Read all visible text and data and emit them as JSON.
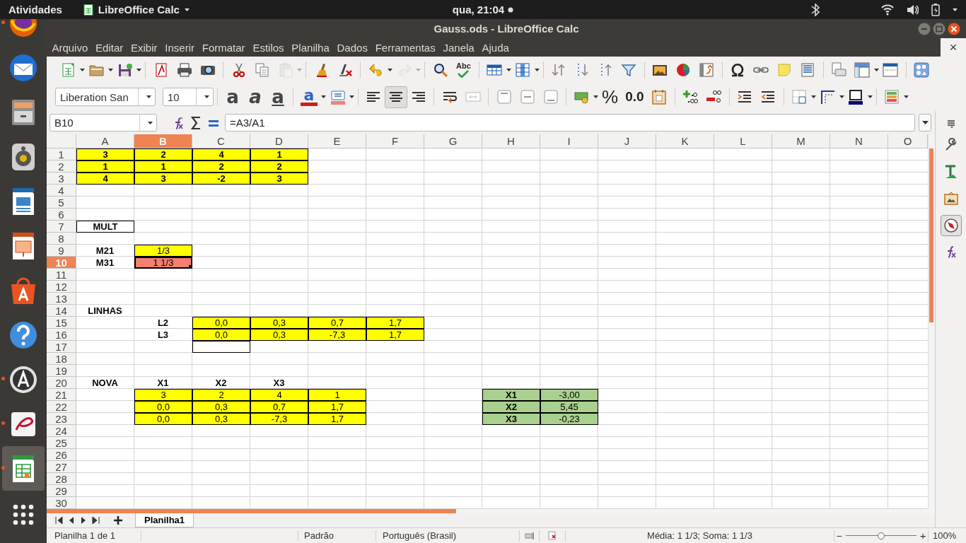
{
  "top_bar": {
    "activities": "Atividades",
    "app_menu": "LibreOffice Calc",
    "clock": "qua, 21:04"
  },
  "dock": {
    "items": [
      {
        "running": true,
        "selected": false
      },
      {
        "running": false,
        "selected": false
      },
      {
        "running": false,
        "selected": false
      },
      {
        "running": false,
        "selected": false
      },
      {
        "running": false,
        "selected": false
      },
      {
        "running": false,
        "selected": false
      },
      {
        "running": false,
        "selected": false
      },
      {
        "running": false,
        "selected": false
      },
      {
        "running": true,
        "selected": false
      },
      {
        "running": true,
        "selected": false
      },
      {
        "running": true,
        "selected": true
      }
    ]
  },
  "window": {
    "title": "Gauss.ods - LibreOffice Calc",
    "close_document": "×"
  },
  "menu_bar": [
    "Arquivo",
    "Editar",
    "Exibir",
    "Inserir",
    "Formatar",
    "Estilos",
    "Planilha",
    "Dados",
    "Ferramentas",
    "Janela",
    "Ajuda"
  ],
  "standard_toolbar": {
    "spelling_label": "Abc",
    "paste": {
      "disabled": true
    },
    "redo": {
      "disabled": true
    }
  },
  "formatting_toolbar": {
    "font_name": "Liberation San",
    "font_size": "10",
    "text_buttons": [
      {
        "label": "a",
        "selected": false
      },
      {
        "label": "a",
        "selected": false
      },
      {
        "label": "a",
        "selected": false
      }
    ],
    "font_color": {
      "label": "a"
    },
    "align_buttons": [
      {
        "selected": false
      },
      {
        "selected": true
      },
      {
        "selected": false
      }
    ],
    "percent": "%",
    "decimal": "0.0"
  },
  "formula_bar": {
    "cell_ref": "B10",
    "formula": "=A3/A1"
  },
  "sheet": {
    "columns": [
      {
        "label": "A",
        "selected": false
      },
      {
        "label": "B",
        "selected": true
      },
      {
        "label": "C",
        "selected": false
      },
      {
        "label": "D",
        "selected": false
      },
      {
        "label": "E",
        "selected": false
      },
      {
        "label": "F",
        "selected": false
      },
      {
        "label": "G",
        "selected": false
      },
      {
        "label": "H",
        "selected": false
      },
      {
        "label": "I",
        "selected": false
      },
      {
        "label": "J",
        "selected": false
      },
      {
        "label": "K",
        "selected": false
      },
      {
        "label": "L",
        "selected": false
      },
      {
        "label": "M",
        "selected": false
      },
      {
        "label": "N",
        "selected": false
      },
      {
        "label": "O",
        "selected": false
      }
    ],
    "rows": [
      {
        "label": "1",
        "selected": false,
        "cells": {
          "A": {
            "text": "3",
            "bold": true,
            "bordered": true,
            "color": "#ffff00",
            "selected": false
          },
          "B": {
            "text": "2",
            "bold": true,
            "bordered": true,
            "color": "#ffff00",
            "selected": false
          },
          "C": {
            "text": "4",
            "bold": true,
            "bordered": true,
            "color": "#ffff00",
            "selected": false
          },
          "D": {
            "text": "1",
            "bold": true,
            "bordered": true,
            "color": "#ffff00",
            "selected": false
          }
        }
      },
      {
        "label": "2",
        "selected": false,
        "cells": {
          "A": {
            "text": "1",
            "bold": true,
            "bordered": true,
            "color": "#ffff00",
            "selected": false
          },
          "B": {
            "text": "1",
            "bold": true,
            "bordered": true,
            "color": "#ffff00",
            "selected": false
          },
          "C": {
            "text": "2",
            "bold": true,
            "bordered": true,
            "color": "#ffff00",
            "selected": false
          },
          "D": {
            "text": "2",
            "bold": true,
            "bordered": true,
            "color": "#ffff00",
            "selected": false
          }
        }
      },
      {
        "label": "3",
        "selected": false,
        "cells": {
          "A": {
            "text": "4",
            "bold": true,
            "bordered": true,
            "color": "#ffff00",
            "selected": false
          },
          "B": {
            "text": "3",
            "bold": true,
            "bordered": true,
            "color": "#ffff00",
            "selected": false
          },
          "C": {
            "text": "-2",
            "bold": true,
            "bordered": true,
            "color": "#ffff00",
            "selected": false
          },
          "D": {
            "text": "3",
            "bold": true,
            "bordered": true,
            "color": "#ffff00",
            "selected": false
          }
        }
      },
      {
        "label": "4",
        "selected": false
      },
      {
        "label": "5",
        "selected": false
      },
      {
        "label": "6",
        "selected": false
      },
      {
        "label": "7",
        "selected": false,
        "cells": {
          "A": {
            "text": "MULT",
            "bold": true,
            "bordered": true,
            "selected": false
          }
        }
      },
      {
        "label": "8",
        "selected": false
      },
      {
        "label": "9",
        "selected": false,
        "cells": {
          "A": {
            "text": "M21",
            "bold": true,
            "bordered": false,
            "selected": false
          },
          "B": {
            "text": "1/3",
            "bold": false,
            "bordered": true,
            "color": "#ffff00",
            "selected": false
          }
        }
      },
      {
        "label": "10",
        "selected": true,
        "cells": {
          "A": {
            "text": "M31",
            "bold": true,
            "bordered": false,
            "selected": false
          },
          "B": {
            "text": "1 1/3",
            "bold": false,
            "bordered": true,
            "color": "#f4806f",
            "selected": true
          }
        }
      },
      {
        "label": "11",
        "selected": false
      },
      {
        "label": "12",
        "selected": false
      },
      {
        "label": "13",
        "selected": false
      },
      {
        "label": "14",
        "selected": false,
        "cells": {
          "A": {
            "text": "LINHAS",
            "bold": true,
            "bordered": false,
            "selected": false
          }
        }
      },
      {
        "label": "15",
        "selected": false,
        "cells": {
          "B": {
            "text": "L2",
            "bold": true,
            "bordered": false,
            "selected": false
          },
          "C": {
            "text": "0,0",
            "bold": false,
            "bordered": true,
            "color": "#ffff00",
            "selected": false
          },
          "D": {
            "text": "0,3",
            "bold": false,
            "bordered": true,
            "color": "#ffff00",
            "selected": false
          },
          "E": {
            "text": "0,7",
            "bold": false,
            "bordered": true,
            "color": "#ffff00",
            "selected": false
          },
          "F": {
            "text": "1,7",
            "bold": false,
            "bordered": true,
            "color": "#ffff00",
            "selected": false
          }
        }
      },
      {
        "label": "16",
        "selected": false,
        "cells": {
          "B": {
            "text": "L3",
            "bold": true,
            "bordered": false,
            "selected": false
          },
          "C": {
            "text": "0,0",
            "bold": false,
            "bordered": true,
            "color": "#ffff00",
            "selected": false
          },
          "D": {
            "text": "0,3",
            "bold": false,
            "bordered": true,
            "color": "#ffff00",
            "selected": false
          },
          "E": {
            "text": "-7,3",
            "bold": false,
            "bordered": true,
            "color": "#ffff00",
            "selected": false
          },
          "F": {
            "text": "1,7",
            "bold": false,
            "bordered": true,
            "color": "#ffff00",
            "selected": false
          }
        }
      },
      {
        "label": "17",
        "selected": false,
        "cells": {
          "C": {
            "bold": false,
            "bordered": true,
            "selected": false
          }
        }
      },
      {
        "label": "18",
        "selected": false
      },
      {
        "label": "19",
        "selected": false
      },
      {
        "label": "20",
        "selected": false,
        "cells": {
          "A": {
            "text": "NOVA",
            "bold": true,
            "bordered": false,
            "selected": false
          },
          "B": {
            "text": "X1",
            "bold": true,
            "bordered": false,
            "selected": false
          },
          "C": {
            "text": "X2",
            "bold": true,
            "bordered": false,
            "selected": false
          },
          "D": {
            "text": "X3",
            "bold": true,
            "bordered": false,
            "selected": false
          }
        }
      },
      {
        "label": "21",
        "selected": false,
        "cells": {
          "B": {
            "text": "3",
            "bold": false,
            "bordered": true,
            "color": "#ffff00",
            "selected": false
          },
          "C": {
            "text": "2",
            "bold": false,
            "bordered": true,
            "color": "#ffff00",
            "selected": false
          },
          "D": {
            "text": "4",
            "bold": false,
            "bordered": true,
            "color": "#ffff00",
            "selected": false
          },
          "E": {
            "text": "1",
            "bold": false,
            "bordered": true,
            "color": "#ffff00",
            "selected": false
          },
          "H": {
            "text": "X1",
            "bold": true,
            "bordered": true,
            "color": "#a9d08e",
            "selected": false
          },
          "I": {
            "text": "-3,00",
            "bold": false,
            "bordered": true,
            "color": "#a9d08e",
            "selected": false
          }
        }
      },
      {
        "label": "22",
        "selected": false,
        "cells": {
          "B": {
            "text": "0,0",
            "bold": false,
            "bordered": true,
            "color": "#ffff00",
            "selected": false
          },
          "C": {
            "text": "0,3",
            "bold": false,
            "bordered": true,
            "color": "#ffff00",
            "selected": false
          },
          "D": {
            "text": "0,7",
            "bold": false,
            "bordered": true,
            "color": "#ffff00",
            "selected": false
          },
          "E": {
            "text": "1,7",
            "bold": false,
            "bordered": true,
            "color": "#ffff00",
            "selected": false
          },
          "H": {
            "text": "X2",
            "bold": true,
            "bordered": true,
            "color": "#a9d08e",
            "selected": false
          },
          "I": {
            "text": "5,45",
            "bold": false,
            "bordered": true,
            "color": "#a9d08e",
            "selected": false
          }
        }
      },
      {
        "label": "23",
        "selected": false,
        "cells": {
          "B": {
            "text": "0,0",
            "bold": false,
            "bordered": true,
            "color": "#ffff00",
            "selected": false
          },
          "C": {
            "text": "0,3",
            "bold": false,
            "bordered": true,
            "color": "#ffff00",
            "selected": false
          },
          "D": {
            "text": "-7,3",
            "bold": false,
            "bordered": true,
            "color": "#ffff00",
            "selected": false
          },
          "E": {
            "text": "1,7",
            "bold": false,
            "bordered": true,
            "color": "#ffff00",
            "selected": false
          },
          "H": {
            "text": "X3",
            "bold": true,
            "bordered": true,
            "color": "#a9d08e",
            "selected": false
          },
          "I": {
            "text": "-0,23",
            "bold": false,
            "bordered": true,
            "color": "#a9d08e",
            "selected": false
          }
        }
      },
      {
        "label": "24",
        "selected": false
      },
      {
        "label": "25",
        "selected": false
      },
      {
        "label": "26",
        "selected": false
      },
      {
        "label": "27",
        "selected": false
      },
      {
        "label": "28",
        "selected": false
      },
      {
        "label": "29",
        "selected": false
      },
      {
        "label": "30",
        "selected": false
      }
    ]
  },
  "sheet_tabs": [
    {
      "label": "Planilha1",
      "selected": true
    }
  ],
  "sidebar": {
    "tabs": [
      {
        "selected": false
      },
      {
        "selected": false
      },
      {
        "selected": false
      },
      {
        "selected": true
      },
      {
        "selected": false
      }
    ]
  },
  "status_bar": {
    "sheet": "Planilha 1 de 1",
    "style": "Padrão",
    "language": "Português (Brasil)",
    "summary": "Média: 1 1/3; Soma: 1 1/3",
    "zoom_out": "−",
    "zoom": {
      "level": 0.5
    },
    "zoom_in": "+",
    "zoom_percent": "100%"
  }
}
